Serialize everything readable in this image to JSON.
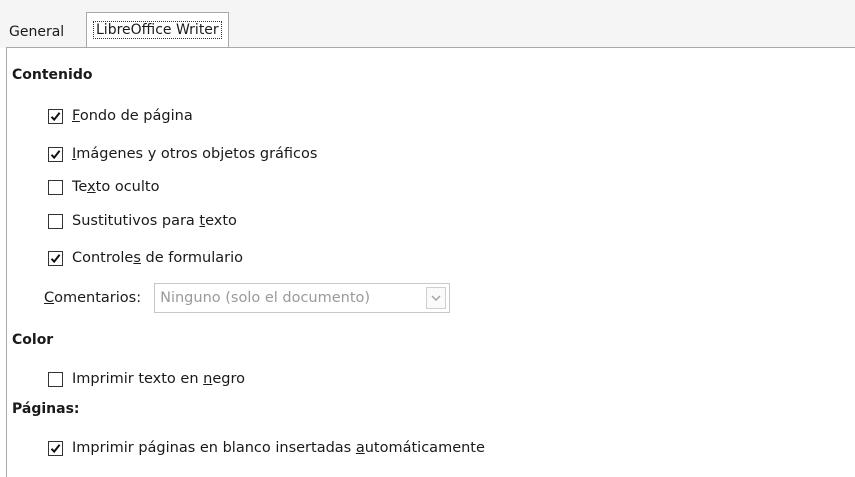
{
  "tabs": {
    "general": "General",
    "writer": "LibreOffice Writer"
  },
  "sections": {
    "contents": "Contenido",
    "color": "Color",
    "pages": "Páginas:"
  },
  "options": {
    "background_pre": "",
    "background_u": "F",
    "background_post": "ondo de página",
    "images_pre": "",
    "images_u": "I",
    "images_post": "mágenes y otros objetos gráficos",
    "hidden_pre": "Te",
    "hidden_u": "x",
    "hidden_post": "to oculto",
    "placeholders_pre": "Sustitutivos para ",
    "placeholders_u": "t",
    "placeholders_post": "exto",
    "controls_pre": "Controle",
    "controls_u": "s",
    "controls_post": " de formulario",
    "black_pre": "Imprimir texto en ",
    "black_u": "n",
    "black_post": "egro",
    "blank_pre": "Imprimir páginas en blanco insertadas ",
    "blank_u": "a",
    "blank_post": "utomáticamente"
  },
  "checked": {
    "background": true,
    "images": true,
    "hidden": false,
    "placeholders": false,
    "controls": true,
    "black": false,
    "blank": true
  },
  "comments": {
    "label_u": "C",
    "label_post": "omentarios:",
    "value": "Ninguno (solo el documento)"
  }
}
